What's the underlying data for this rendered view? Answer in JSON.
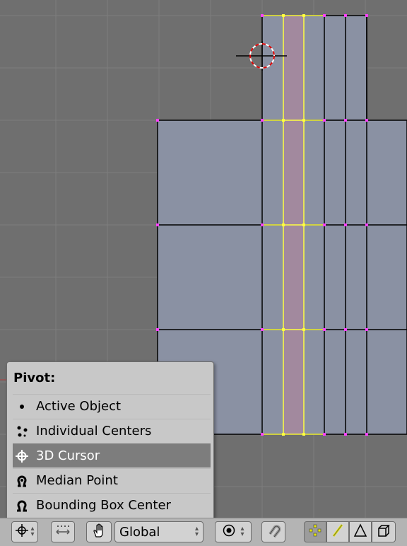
{
  "pivot_menu": {
    "title": "Pivot:",
    "items": [
      {
        "label": "Active Object",
        "icon": "dot-icon",
        "selected": false
      },
      {
        "label": "Individual Centers",
        "icon": "individual-centers-icon",
        "selected": false
      },
      {
        "label": "3D Cursor",
        "icon": "cursor-crosshair-icon",
        "selected": true
      },
      {
        "label": "Median Point",
        "icon": "median-point-icon",
        "selected": false
      },
      {
        "label": "Bounding Box Center",
        "icon": "bounding-box-icon",
        "selected": false
      }
    ]
  },
  "header": {
    "orientation": "Global"
  },
  "colors": {
    "grid_background": "#6f6f6f",
    "face": "#8a91a3",
    "selected_face": "#a2899e",
    "selected_edge": "#ffff40",
    "vertex": "#ff40ff",
    "menu_background": "#c8c8c8",
    "menu_selected": "#7d7d7d"
  }
}
